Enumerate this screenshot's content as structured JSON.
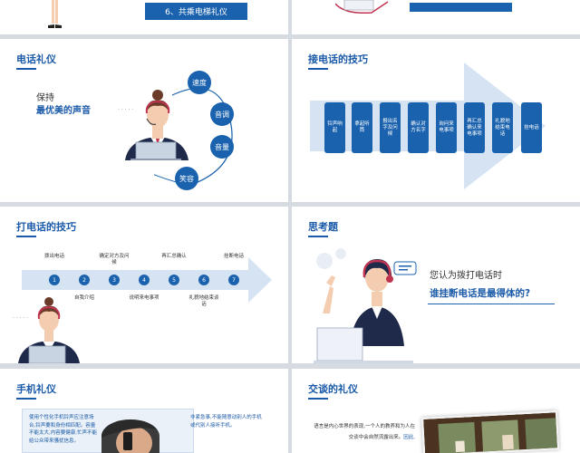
{
  "slide1": {
    "item6": "6、共乘电梯礼仪"
  },
  "slide3": {
    "title": "电话礼仪",
    "keep": "保持",
    "best_voice": "最优美的声音",
    "bubble": "· · · · ·",
    "circles": [
      "速度",
      "音调",
      "音量",
      "笑容"
    ]
  },
  "slide4": {
    "title": "接电话的技巧",
    "steps": [
      "铃声响起",
      "拿起听筒",
      "报出名字及问候",
      "确认对方名字",
      "询问来电事项",
      "再汇总确认来电事项",
      "礼貌地结束电话",
      "挂电话"
    ]
  },
  "slide5": {
    "title": "打电话的技巧",
    "bubble": "· · · · ·",
    "numbers": [
      "1",
      "2",
      "3",
      "4",
      "5",
      "6",
      "7"
    ],
    "top_labels": [
      "拨出电话",
      "确定对方及问候",
      "再汇总确认",
      "挂断电话"
    ],
    "bottom_labels": [
      "自我介绍",
      "说明来电事项",
      "礼貌地结束谈话"
    ]
  },
  "slide6": {
    "title": "思考题",
    "question1": "您认为拨打电话时",
    "question2": "谁挂断电话是最得体的?"
  },
  "slide7": {
    "title": "手机礼仪",
    "text1": "使用个性化手机铃声应注意场合,铃声要和身份相匹配。容量不能太大,内容要健康,忙声不能给公众带来骚扰信息。",
    "text2": "非紧急事,不能随意动别人的手机或代别人接听手机。"
  },
  "slide8": {
    "title": "交谈的礼仪",
    "text": "语言是内心世界的表现,一个人的教养和为人在交谈中会自然流露出来。",
    "highlight": "因此,"
  }
}
